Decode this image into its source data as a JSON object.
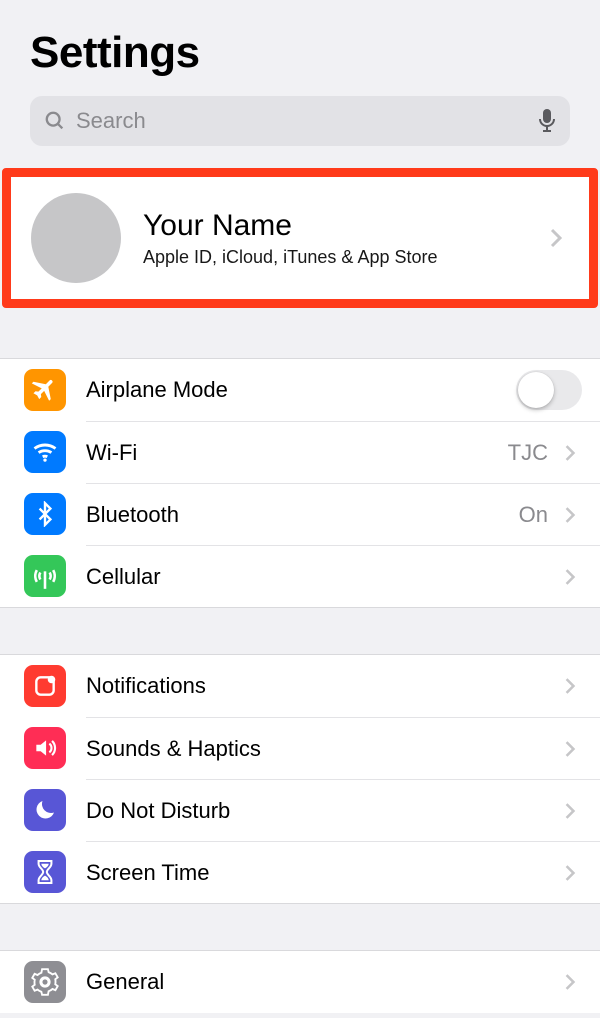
{
  "header": {
    "title": "Settings"
  },
  "search": {
    "placeholder": "Search"
  },
  "profile": {
    "name": "Your Name",
    "subtitle": "Apple ID, iCloud, iTunes & App Store"
  },
  "group1": {
    "airplane": {
      "label": "Airplane Mode",
      "color": "#ff9500"
    },
    "wifi": {
      "label": "Wi-Fi",
      "value": "TJC",
      "color": "#007aff"
    },
    "bluetooth": {
      "label": "Bluetooth",
      "value": "On",
      "color": "#007aff"
    },
    "cellular": {
      "label": "Cellular",
      "color": "#34c759"
    }
  },
  "group2": {
    "notifications": {
      "label": "Notifications",
      "color": "#ff3b30"
    },
    "sounds": {
      "label": "Sounds & Haptics",
      "color": "#ff2d55"
    },
    "dnd": {
      "label": "Do Not Disturb",
      "color": "#5856d6"
    },
    "screentime": {
      "label": "Screen Time",
      "color": "#5856d6"
    }
  },
  "group3": {
    "general": {
      "label": "General",
      "color": "#8e8e93"
    }
  }
}
